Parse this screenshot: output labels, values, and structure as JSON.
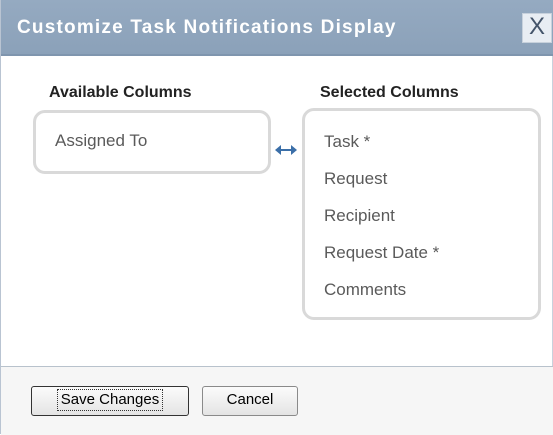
{
  "dialog": {
    "title": "Customize Task Notifications Display",
    "close_label": "X"
  },
  "available": {
    "heading": "Available Columns",
    "items": [
      "Assigned To"
    ]
  },
  "selected": {
    "heading": "Selected Columns",
    "items": [
      "Task *",
      "Request",
      "Recipient",
      "Request Date *",
      "Comments"
    ]
  },
  "swap_icon": "double-arrow-icon",
  "footer": {
    "save_label": "Save Changes",
    "cancel_label": "Cancel"
  },
  "colors": {
    "titlebar": "#8ba1b9",
    "arrow": "#3b6fa8"
  }
}
